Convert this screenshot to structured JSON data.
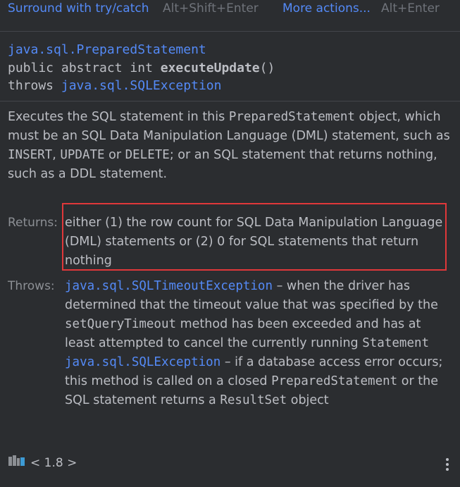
{
  "actions": {
    "surround_label": "Surround with try/catch",
    "surround_shortcut": "Alt+Shift+Enter",
    "more_label": "More actions...",
    "more_shortcut": "Alt+Enter"
  },
  "signature": {
    "class_name": "java.sql.PreparedStatement",
    "modifiers": "public abstract int",
    "method_name": "executeUpdate",
    "params": "()",
    "throws_keyword": "throws",
    "exception": "java.sql.SQLException"
  },
  "description": {
    "t1": "Executes the SQL statement in this ",
    "c1": "PreparedStatement",
    "t2": " object, which must be an SQL Data Manipulation Language (DML) statement, such as ",
    "c2": "INSERT",
    "t3": ", ",
    "c3": "UPDATE",
    "t4": " or ",
    "c4": "DELETE",
    "t5": "; or an SQL statement that returns nothing, such as a DDL statement."
  },
  "returns": {
    "label": "Returns:",
    "text": "either (1) the row count for SQL Data Manipulation Language (DML) statements or (2) 0 for SQL statements that return nothing"
  },
  "throws": {
    "label": "Throws:",
    "ex1_name": "java.sql.SQLTimeoutException",
    "ex1_t1": " – when the driver has determined that the timeout value that was specified by the ",
    "ex1_c1": "setQueryTimeout",
    "ex1_t2": " method has been exceeded and has at least attempted to cancel the currently running ",
    "ex1_c2": "Statement",
    "ex2_name": "java.sql.SQLException",
    "ex2_t1": " – if a database access error occurs; this method is called on a closed ",
    "ex2_c1": "PreparedStatement",
    "ex2_t2": " or the SQL statement returns a ",
    "ex2_c2": "ResultSet",
    "ex2_t3": " object"
  },
  "footer": {
    "library_icon": "library-icon",
    "version": "< 1.8 >",
    "menu_icon": "more-vertical-icon"
  },
  "colors": {
    "background": "#2b2d30",
    "link": "#548af7",
    "highlight": "#e0383a"
  }
}
